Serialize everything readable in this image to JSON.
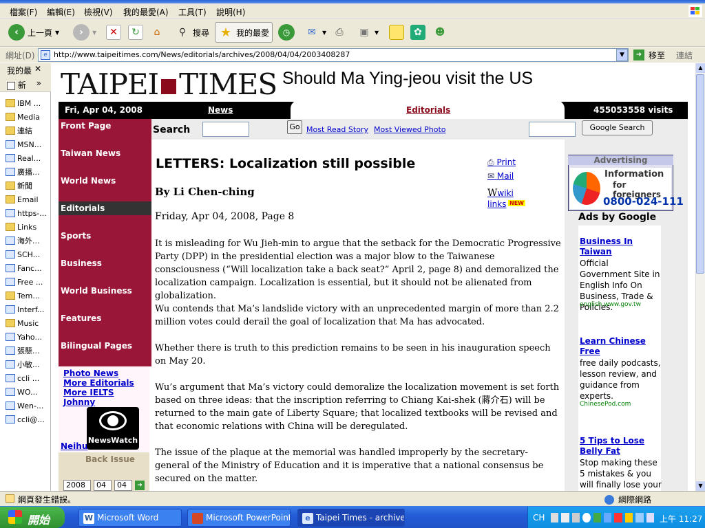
{
  "menubar": [
    "檔案(F)",
    "編輯(E)",
    "檢視(V)",
    "我的最愛(A)",
    "工具(T)",
    "說明(H)"
  ],
  "toolbar": {
    "back": "上一頁",
    "search": "搜尋",
    "favorites": "我的最愛"
  },
  "address": {
    "label": "網址(D)",
    "url": "http://www.taipeitimes.com/News/editorials/archives/2008/04/04/2003408287",
    "go": "移至",
    "links": "連結"
  },
  "favorites": {
    "title": "我的最",
    "new_label": "新",
    "items": [
      {
        "label": "IBM ...",
        "type": "folder"
      },
      {
        "label": "Media",
        "type": "folder"
      },
      {
        "label": "連結",
        "type": "folder"
      },
      {
        "label": "MSN...",
        "type": "page"
      },
      {
        "label": "Real...",
        "type": "page"
      },
      {
        "label": "廣播...",
        "type": "page"
      },
      {
        "label": "新聞",
        "type": "folder"
      },
      {
        "label": "Email",
        "type": "folder"
      },
      {
        "label": "https-...",
        "type": "page"
      },
      {
        "label": "Links",
        "type": "folder"
      },
      {
        "label": "海外...",
        "type": "page"
      },
      {
        "label": "SCH...",
        "type": "page"
      },
      {
        "label": "Fanc...",
        "type": "page"
      },
      {
        "label": "Free ...",
        "type": "page"
      },
      {
        "label": "Tem...",
        "type": "folder"
      },
      {
        "label": "Interf...",
        "type": "page"
      },
      {
        "label": "Music",
        "type": "folder"
      },
      {
        "label": "Yaho...",
        "type": "page"
      },
      {
        "label": "張懸...",
        "type": "page"
      },
      {
        "label": "小敏...",
        "type": "page"
      },
      {
        "label": "ccli ...",
        "type": "page"
      },
      {
        "label": "WO...",
        "type": "page"
      },
      {
        "label": "Wen-...",
        "type": "page"
      },
      {
        "label": "ccli@...",
        "type": "page"
      }
    ]
  },
  "site": {
    "logo_left": "TAIPEI",
    "logo_right": "TIMES",
    "headline": "Should Ma Ying-jeou visit the US",
    "date": "Fri, Apr 04, 2008",
    "news": "News",
    "section": "Editorials",
    "visits": "455053558 visits",
    "search_label": "Search",
    "go": "Go",
    "most_read": "Most Read Story",
    "most_viewed": "Most Viewed Photo",
    "google_search": "Google Search"
  },
  "nav": [
    "Front Page",
    "Taiwan News",
    "World News",
    "Editorials",
    "Sports",
    "Business",
    "World Business",
    "Features",
    "Bilingual Pages"
  ],
  "sidelinks": [
    "Photo News",
    "More Editorials",
    "More IELTS",
    "Johnny",
    "Neihu"
  ],
  "newswatch": "NewsWatch",
  "back_issue": {
    "label": "Back Issue",
    "year": "2008",
    "month": "04",
    "day": "04"
  },
  "article": {
    "title": "LETTERS: Localization still possible",
    "byline": "By Li Chen-ching",
    "date": "Friday, Apr 04, 2008, Page 8",
    "print": "Print",
    "mail": "Mail",
    "wiki": "wiki links",
    "new_badge": "NEW",
    "paragraphs": [
      "It is misleading for Wu Jieh-min to argue that the setback for the Democratic Progressive Party (DPP) in the presidential election was a major blow to the Taiwanese consciousness (“Will localization take a back seat?” April 2, page 8) and demoralized the localization campaign. Localization is essential, but it should not be alienated from globalization.",
      "Wu contends that Ma’s landslide victory with an unprecedented margin of more than 2.2 million votes could derail the goal of localization that Ma has advocated.",
      "Whether there is truth to this prediction remains to be seen in his inauguration speech on May 20.",
      "Wu’s argument that Ma’s victory could demoralize the localization movement is set forth based on three ideas: that the inscription referring to Chiang Kai-shek (蔣介石) will be returned to the main gate of Liberty Square; that localized textbooks will be revised and that economic relations with China will be deregulated.",
      "The issue of the plaque at the memorial was handled improperly by the secretary-general of the Ministry of Education and it is imperative that a national consensus be secured on the matter."
    ]
  },
  "advert": {
    "label": "Advertising",
    "line1": "Information",
    "line2": "for foreigners",
    "phone": "0800-024-111",
    "ads_by": "Ads by Google"
  },
  "google_ads": [
    {
      "title": "Business In Taiwan",
      "desc": "Official Government Site in English Info On Business, Trade & Policies.",
      "url": "english.www.gov.tw"
    },
    {
      "title": "Learn Chinese Free",
      "desc": "free daily podcasts, lesson review, and guidance from experts.",
      "url": "ChinesePod.com"
    },
    {
      "title": "5 Tips to Lose Belly Fat",
      "desc": "Stop making these 5 mistakes & you will finally lose your",
      "url": ""
    }
  ],
  "status": {
    "text": "網頁發生錯誤。",
    "zone": "網際網路"
  },
  "taskbar": {
    "start": "開始",
    "tasks": [
      "Microsoft Word",
      "Microsoft PowerPoint ...",
      "Taipei Times - archive..."
    ],
    "ime": "CH",
    "clock": "上午 11:27"
  }
}
